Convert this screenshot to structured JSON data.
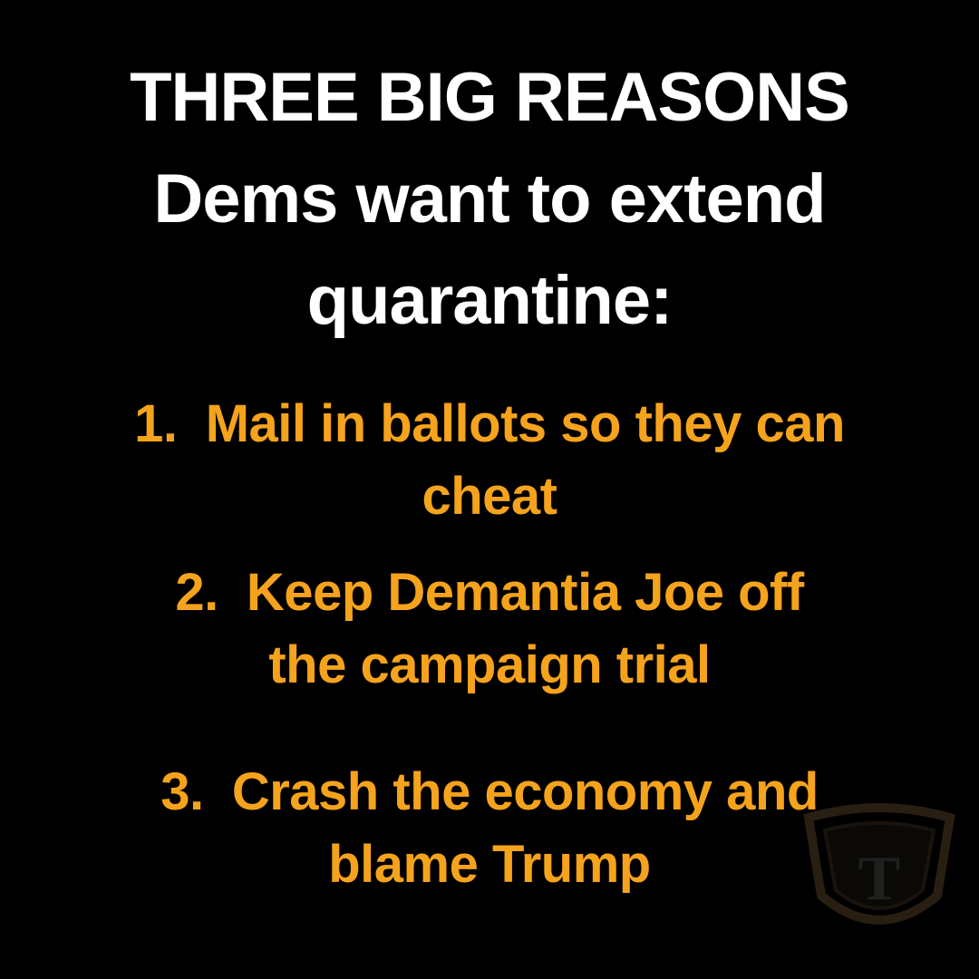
{
  "headline": {
    "line_1": "THREE BIG REASONS",
    "line_2": "Dems want to extend",
    "line_3": "quarantine:"
  },
  "reasons": [
    {
      "number": "1.",
      "line_1": "Mail in ballots so they can",
      "line_2": "cheat"
    },
    {
      "number": "2.",
      "line_1": "Keep Demantia Joe off",
      "line_2": "the campaign trial"
    },
    {
      "number": "3.",
      "line_1": "Crash the economy and",
      "line_2": "blame Trump"
    }
  ],
  "watermark": {
    "letter": "T"
  },
  "colors": {
    "background": "#000000",
    "headline": "#ffffff",
    "reasons": "#f5a31c",
    "watermark": "#4a3a22"
  }
}
